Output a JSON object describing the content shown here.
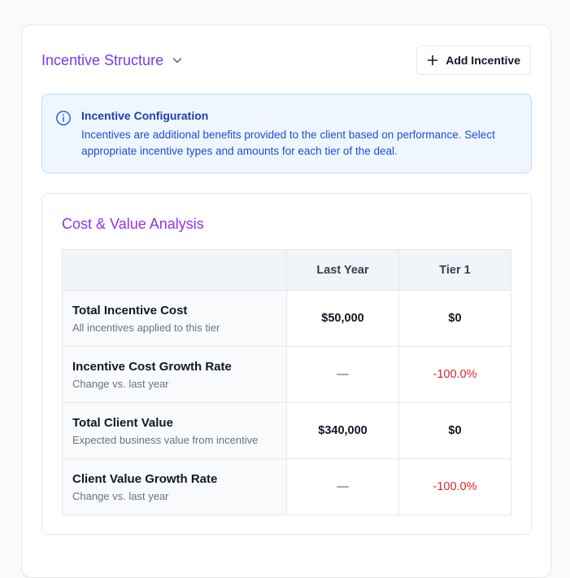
{
  "section": {
    "title": "Incentive Structure",
    "add_button_label": "Add Incentive"
  },
  "info": {
    "title": "Incentive Configuration",
    "text": "Incentives are additional benefits provided to the client based on performance. Select appropriate incentive types and amounts for each tier of the deal."
  },
  "analysis": {
    "title": "Cost & Value Analysis",
    "columns": [
      "",
      "Last Year",
      "Tier 1"
    ],
    "rows": [
      {
        "label": "Total Incentive Cost",
        "sub": "All incentives applied to this tier",
        "last_year": "$50,000",
        "tier1": "$0"
      },
      {
        "label": "Incentive Cost Growth Rate",
        "sub": "Change vs. last year",
        "last_year": "—",
        "tier1": "-100.0%"
      },
      {
        "label": "Total Client Value",
        "sub": "Expected business value from incentive",
        "last_year": "$340,000",
        "tier1": "$0"
      },
      {
        "label": "Client Value Growth Rate",
        "sub": "Change vs. last year",
        "last_year": "—",
        "tier1": "-100.0%"
      }
    ]
  },
  "colors": {
    "accent": "#7c3aed",
    "info_bg": "#eff6ff",
    "info_text": "#1d4ed8",
    "negative": "#dc2626"
  },
  "icons": {
    "chevron": "chevron-down-icon",
    "plus": "plus-icon",
    "info": "info-icon"
  }
}
